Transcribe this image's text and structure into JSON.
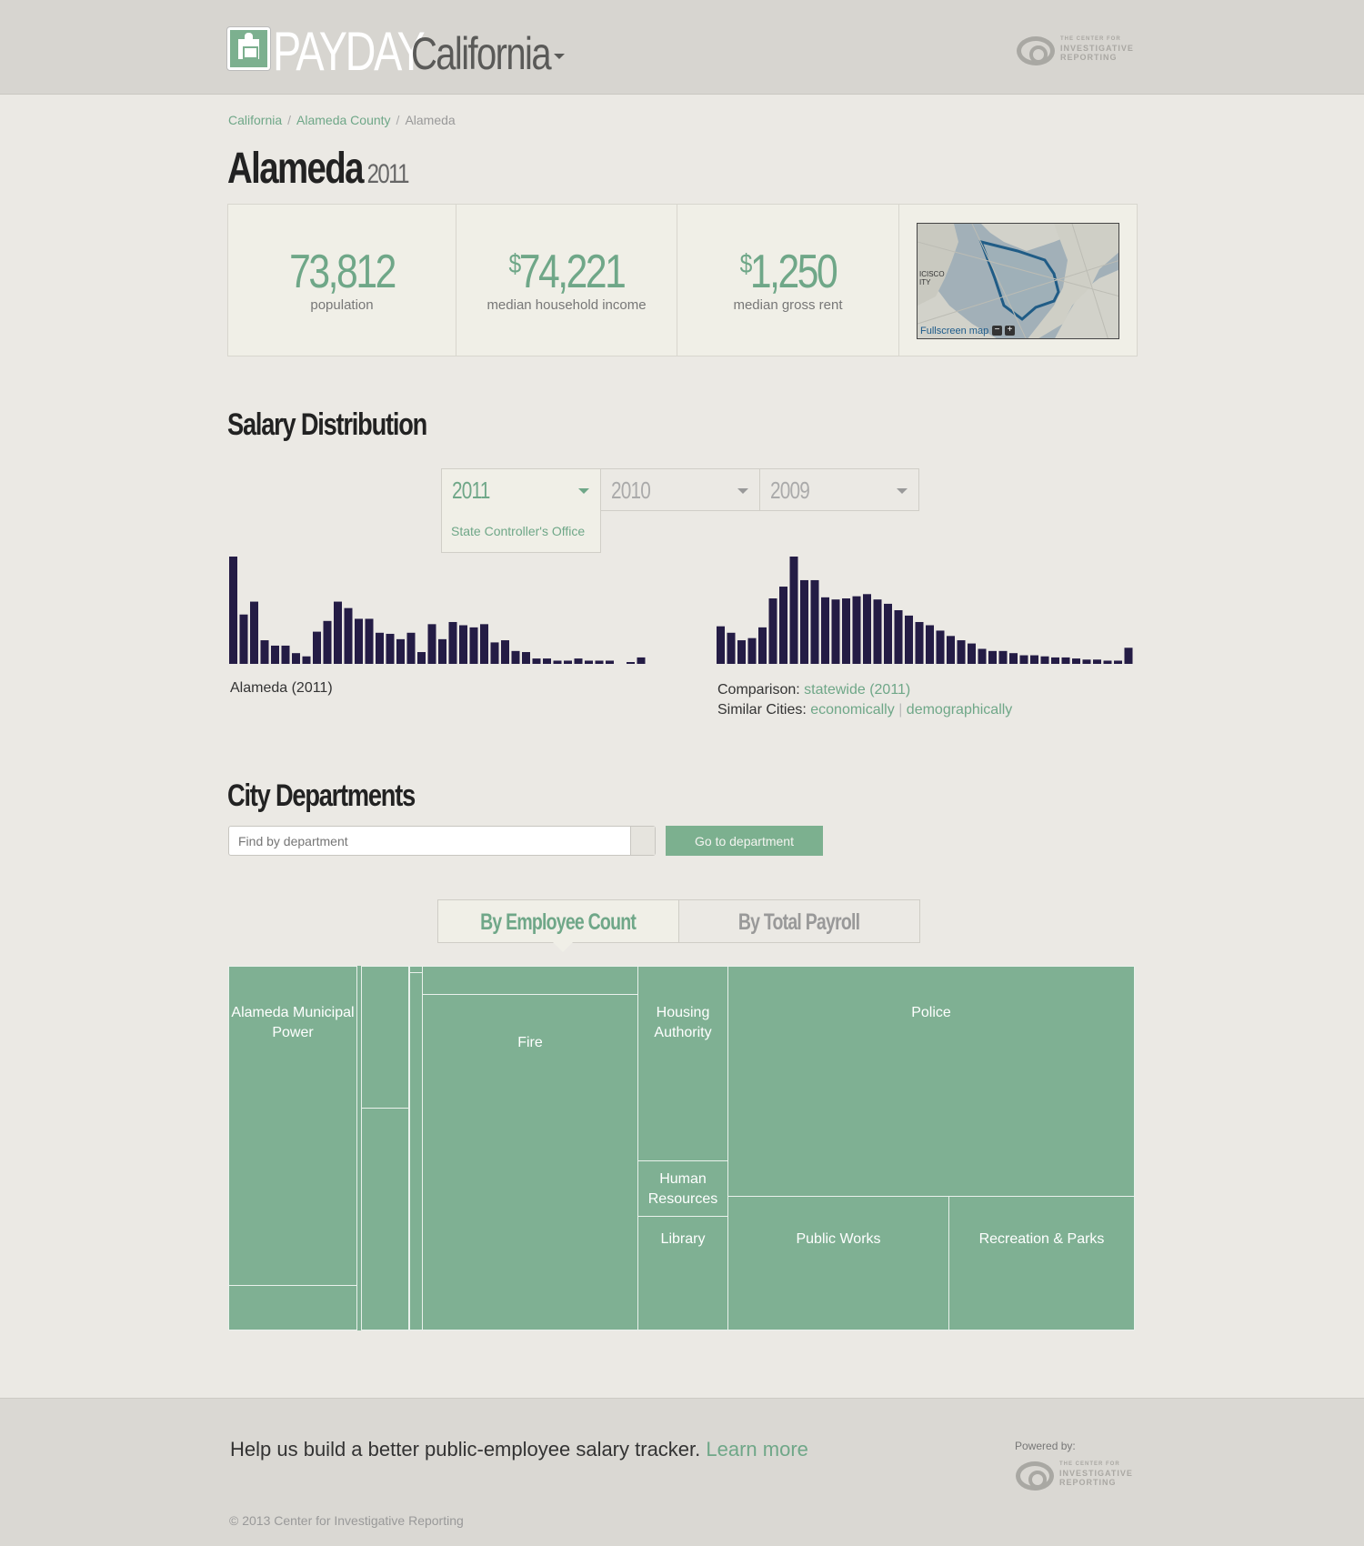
{
  "header": {
    "brand": "PAYDAY",
    "state": "California",
    "cir_logo": {
      "line1": "THE CENTER FOR",
      "line2": "INVESTIGATIVE",
      "line3": "REPORTING"
    }
  },
  "breadcrumb": [
    "California",
    "Alameda County",
    "Alameda"
  ],
  "page": {
    "title": "Alameda",
    "year": "2011"
  },
  "stats": [
    {
      "value": "73,812",
      "prefix": "",
      "label": "population"
    },
    {
      "value": "74,221",
      "prefix": "$",
      "label": "median household income"
    },
    {
      "value": "1,250",
      "prefix": "$",
      "label": "median gross rent"
    }
  ],
  "map": {
    "link": "Fullscreen map",
    "minus": "−",
    "plus": "+",
    "place_label": "ICISCO\nITY"
  },
  "salary": {
    "heading": "Salary Distribution",
    "years": [
      {
        "year": "2011",
        "active": true,
        "source": "State Controller's Office"
      },
      {
        "year": "2010",
        "active": false
      },
      {
        "year": "2009",
        "active": false
      }
    ],
    "caption": "Alameda (2011)",
    "comparison_label": "Comparison:",
    "comparison_link": "statewide (2011)",
    "similar_label": "Similar Cities:",
    "similar_econ": "economically",
    "similar_sep": "|",
    "similar_demo": "demographically"
  },
  "chart_data": [
    {
      "type": "bar",
      "series": [
        {
          "values": [
            100,
            46,
            58,
            22,
            17,
            17,
            10,
            7,
            30,
            40,
            58,
            52,
            42,
            42,
            29,
            28,
            23,
            29,
            11,
            37,
            23,
            39,
            36,
            34,
            37,
            20,
            22,
            12,
            11,
            5,
            5,
            3,
            3,
            5,
            3,
            3,
            3,
            0,
            1,
            6
          ]
        }
      ],
      "ylim": [
        0,
        100
      ]
    },
    {
      "type": "bar",
      "series": [
        {
          "values": [
            35,
            29,
            22,
            24,
            34,
            61,
            72,
            100,
            78,
            78,
            62,
            60,
            61,
            63,
            65,
            60,
            56,
            50,
            45,
            39,
            36,
            31,
            26,
            22,
            19,
            14,
            12,
            12,
            10,
            8,
            8,
            7,
            6,
            6,
            5,
            4,
            4,
            3,
            3,
            15
          ]
        }
      ],
      "ylim": [
        0,
        100
      ]
    }
  ],
  "departments": {
    "heading": "City Departments",
    "search_placeholder": "Find by department",
    "go_label": "Go to department",
    "tabs": [
      "By Employee Count",
      "By Total Payroll"
    ],
    "treemap": [
      {
        "label": "Alameda Municipal Power"
      },
      {
        "label": ""
      },
      {
        "label": ""
      },
      {
        "label": ""
      },
      {
        "label": ""
      },
      {
        "label": ""
      },
      {
        "label": ""
      },
      {
        "label": ""
      },
      {
        "label": "Fire"
      },
      {
        "label": "Housing Authority"
      },
      {
        "label": "Human Resources"
      },
      {
        "label": "Library"
      },
      {
        "label": "Police"
      },
      {
        "label": "Public Works"
      },
      {
        "label": "Recreation & Parks"
      }
    ]
  },
  "footer": {
    "message": "Help us build a better public-employee salary tracker.",
    "link": "Learn more",
    "powered": "Powered by:",
    "copyright": "© 2013 Center for Investigative Reporting"
  },
  "colors": {
    "accent": "#6fa788",
    "bar": "#241c45",
    "treemap": "#7fb093"
  }
}
